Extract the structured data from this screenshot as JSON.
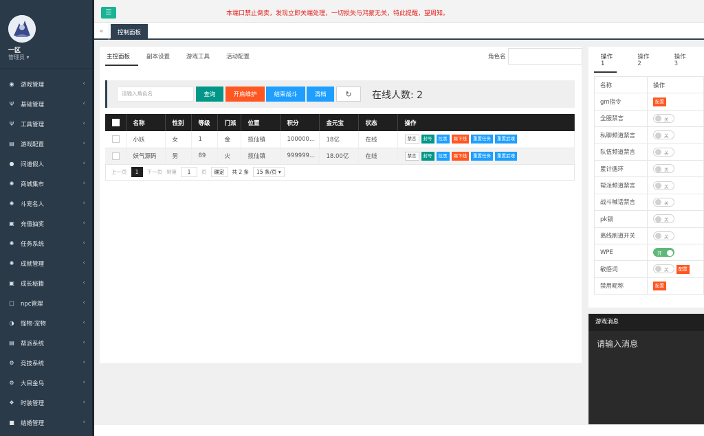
{
  "sidebar": {
    "server": "一区",
    "role": "管理员 ▾",
    "items": [
      {
        "label": "游戏管理",
        "icon": "gamepad-icon"
      },
      {
        "label": "基础管理",
        "icon": "utensils-icon"
      },
      {
        "label": "工具管理",
        "icon": "utensils-icon"
      },
      {
        "label": "游戏配置",
        "icon": "table-icon"
      },
      {
        "label": "问道假人",
        "icon": "user-icon"
      },
      {
        "label": "商城集市",
        "icon": "gear-icon"
      },
      {
        "label": "斗宠名人",
        "icon": "gear-icon"
      },
      {
        "label": "充值抽奖",
        "icon": "money-icon"
      },
      {
        "label": "任务系统",
        "icon": "gear-icon"
      },
      {
        "label": "成就管理",
        "icon": "gear-icon"
      },
      {
        "label": "成长秘籍",
        "icon": "money-icon"
      },
      {
        "label": "npc管理",
        "icon": "square-icon"
      },
      {
        "label": "怪物·宠物",
        "icon": "half-circle-icon"
      },
      {
        "label": "帮派系统",
        "icon": "table-icon"
      },
      {
        "label": "竞技系统",
        "icon": "gears-icon"
      },
      {
        "label": "大目金乌",
        "icon": "gears-icon"
      },
      {
        "label": "时装管理",
        "icon": "cubes-icon"
      },
      {
        "label": "结婚管理",
        "icon": "square-filled-icon"
      }
    ]
  },
  "topbar": {
    "notice": "本端口禁止倒卖，发现立即关端处理，一切损失与鸿蒙无关，特此提醒，望周知。"
  },
  "tabstrip": {
    "active": "控制面板"
  },
  "main": {
    "subtabs": [
      "主控面板",
      "副本设置",
      "游戏工具",
      "活动配置"
    ],
    "role_label": "角色名",
    "search_placeholder": "请输入角色名",
    "buttons": {
      "query": "查询",
      "maint": "开启维护",
      "end": "结束战斗",
      "clear": "清档"
    },
    "online": "在线人数: 2",
    "columns": [
      "名称",
      "性别",
      "等级",
      "门派",
      "位置",
      "积分",
      "金元宝",
      "状态",
      "操作"
    ],
    "rows": [
      {
        "name": "小妖",
        "gender": "女",
        "level": "1",
        "school": "金",
        "location": "揽仙镇",
        "score": "100000...",
        "gold": "18亿",
        "status": "在线"
      },
      {
        "name": "妖气源码",
        "gender": "男",
        "level": "89",
        "school": "火",
        "location": "揽仙镇",
        "score": "999999...",
        "gold": "18.00亿",
        "status": "在线"
      }
    ],
    "actions": {
      "mute": "禁言",
      "ban": "封号",
      "pull": "拉黑",
      "kick": "踢下线",
      "reset_task": "重置任务",
      "reset_weapon": "重置武魂"
    },
    "pager": {
      "prev": "上一页",
      "current": "1",
      "next": "下一页",
      "goto": "到第",
      "page_value": "1",
      "page_unit": "页",
      "ok": "确定",
      "total": "共 2 条",
      "per_page": "15 条/页 ▾"
    }
  },
  "rpanel": {
    "tabs": [
      "操作1",
      "操作2",
      "操作3"
    ],
    "header": [
      "名称",
      "操作"
    ],
    "config": "配置",
    "off": "关",
    "on": "开",
    "rows": [
      {
        "name": "gm指令",
        "type": "config"
      },
      {
        "name": "全服禁言",
        "type": "off"
      },
      {
        "name": "私聊频道禁言",
        "type": "off"
      },
      {
        "name": "队伍频道禁言",
        "type": "off"
      },
      {
        "name": "累计循环",
        "type": "off"
      },
      {
        "name": "帮派频道禁言",
        "type": "off"
      },
      {
        "name": "战斗喊话禁言",
        "type": "off"
      },
      {
        "name": "pk锁",
        "type": "off"
      },
      {
        "name": "离线刷道开关",
        "type": "off"
      },
      {
        "name": "WPE",
        "type": "on"
      },
      {
        "name": "敏感词",
        "type": "off-config"
      },
      {
        "name": "禁用昵称",
        "type": "config"
      }
    ]
  },
  "msg": {
    "title": "游戏消息",
    "placeholder": "请输入消息"
  },
  "colors": {
    "sidebar": "#2b3a48",
    "teal": "#009688",
    "orange": "#ff5722",
    "blue": "#1e9fff",
    "green_switch": "#5fb878",
    "notice_red": "#e2211c"
  }
}
